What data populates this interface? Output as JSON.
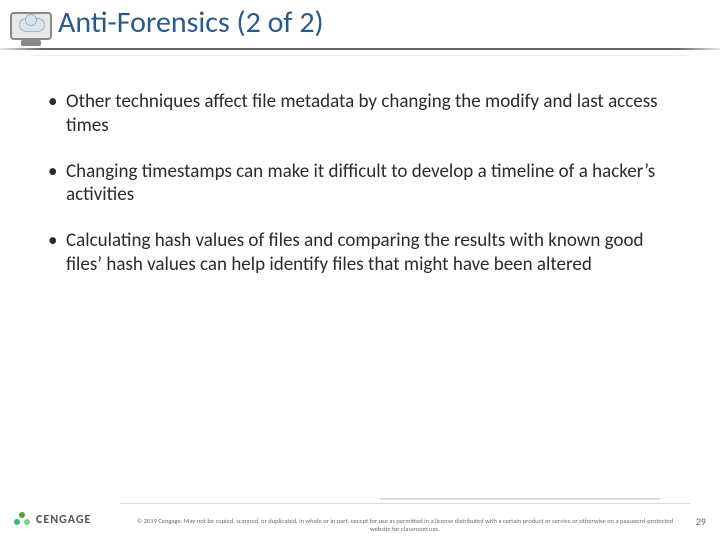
{
  "header": {
    "title": "Anti-Forensics (2 of 2)"
  },
  "bullets": [
    "Other techniques affect file metadata by changing the modify and last access times",
    "Changing timestamps can make it difficult to develop a timeline of a hacker’s activities",
    "Calculating hash values of files and comparing the results with known good files’ hash values can help identify files that might have been altered"
  ],
  "footer": {
    "brand": "CENGAGE",
    "copyright": "© 2019 Cengage. May not be copied, scanned, or duplicated, in whole or in part, except for use as permitted in a license distributed with a certain product or service or otherwise on a password-protected website for classroom use.",
    "page": "29"
  }
}
